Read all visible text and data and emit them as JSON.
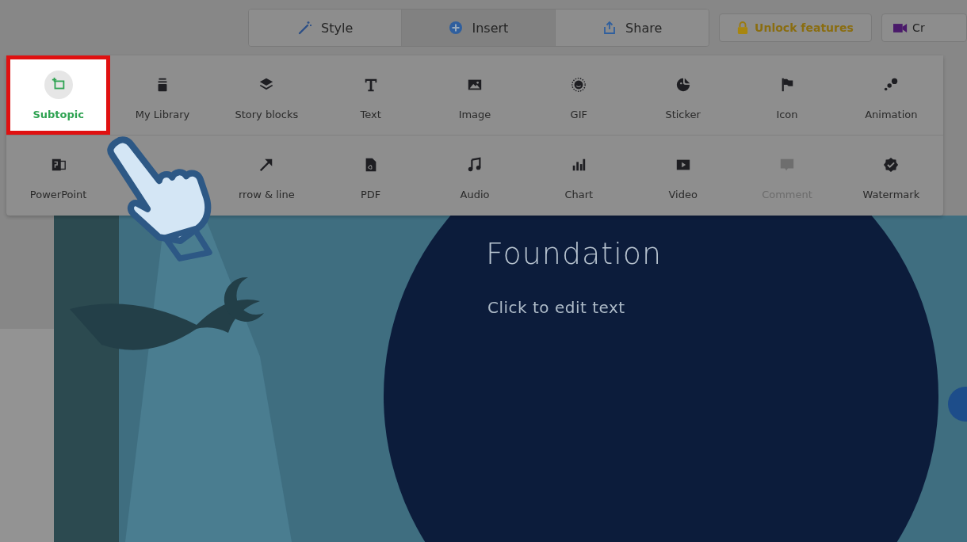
{
  "toolbar": {
    "tabs": [
      {
        "label": "Style",
        "selected": false
      },
      {
        "label": "Insert",
        "selected": true
      },
      {
        "label": "Share",
        "selected": false
      }
    ],
    "unlock_button": "Unlock features",
    "cut_button": "Cr"
  },
  "insert_menu": {
    "rows": [
      [
        {
          "label": "Subtopic",
          "selected": true,
          "disabled": false
        },
        {
          "label": "My Library",
          "selected": false,
          "disabled": false
        },
        {
          "label": "Story blocks",
          "selected": false,
          "disabled": false
        },
        {
          "label": "Text",
          "selected": false,
          "disabled": false
        },
        {
          "label": "Image",
          "selected": false,
          "disabled": false
        },
        {
          "label": "GIF",
          "selected": false,
          "disabled": false
        },
        {
          "label": "Sticker",
          "selected": false,
          "disabled": false
        },
        {
          "label": "Icon",
          "selected": false,
          "disabled": false
        },
        {
          "label": "Animation",
          "selected": false,
          "disabled": false
        }
      ],
      [
        {
          "label": "PowerPoint",
          "selected": false,
          "disabled": false
        },
        {},
        {
          "label": "rrow & line",
          "selected": false,
          "disabled": false
        },
        {
          "label": "PDF",
          "selected": false,
          "disabled": false
        },
        {
          "label": "Audio",
          "selected": false,
          "disabled": false
        },
        {
          "label": "Chart",
          "selected": false,
          "disabled": false
        },
        {
          "label": "Video",
          "selected": false,
          "disabled": false
        },
        {
          "label": "Comment",
          "selected": false,
          "disabled": true
        },
        {
          "label": "Watermark",
          "selected": false,
          "disabled": false
        }
      ]
    ]
  },
  "slide": {
    "title": "Foundation",
    "body": "Click to edit text"
  }
}
